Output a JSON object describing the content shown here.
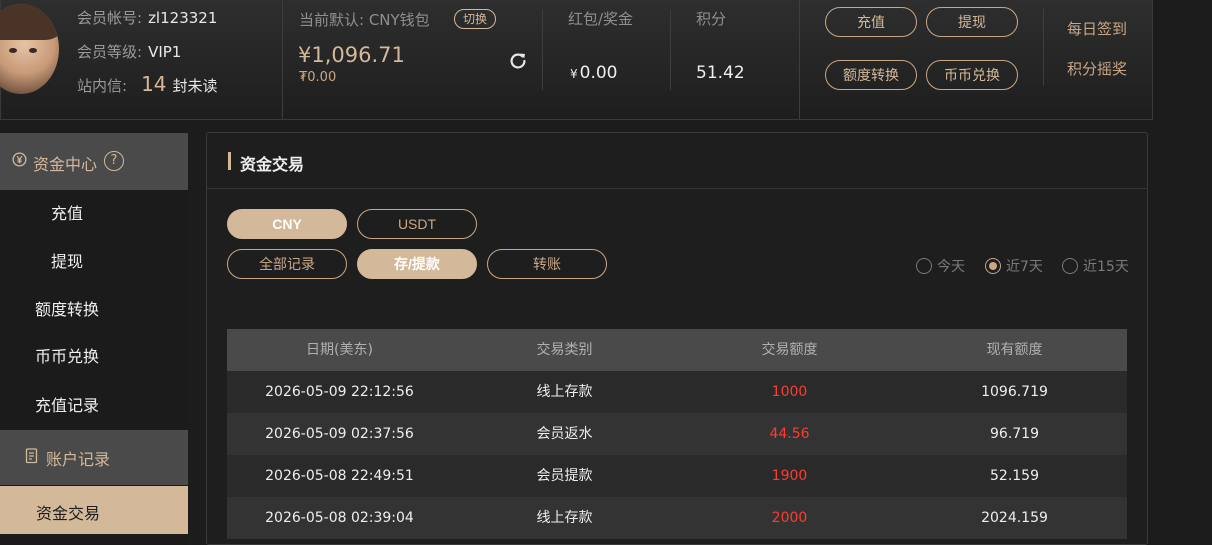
{
  "header": {
    "account_label": "会员帐号:",
    "account_value": "zl123321",
    "level_label": "会员等级:",
    "level_value": "VIP1",
    "mail_label": "站内信:",
    "mail_count": "14",
    "mail_suffix": "封未读",
    "default_wallet_label": "当前默认: CNY钱包",
    "switch_label": "切换",
    "balance": "¥1,096.71",
    "balance_sub": "₮0.00",
    "bonus_label": "红包/奖金",
    "bonus_currency": "¥",
    "bonus_value": "0.00",
    "points_label": "积分",
    "points_value": "51.42",
    "buttons": {
      "recharge": "充值",
      "withdraw": "提现",
      "transfer": "额度转换",
      "exchange": "币币兑换"
    },
    "daily_checkin": "每日签到",
    "points_lottery": "积分摇奖"
  },
  "sidebar": {
    "section_title": "资金中心",
    "items": [
      "充值",
      "提现",
      "额度转换",
      "币币兑换",
      "充值记录"
    ],
    "group_title": "账户记录",
    "active_item": "资金交易"
  },
  "main": {
    "title": "资金交易",
    "currency_tabs": [
      "CNY",
      "USDT"
    ],
    "active_currency": "CNY",
    "record_tabs": [
      "全部记录",
      "存/提款",
      "转账"
    ],
    "active_record_tab": "存/提款",
    "date_filters": [
      "今天",
      "近7天",
      "近15天"
    ],
    "active_date_filter": "近7天",
    "table": {
      "headers": [
        "日期(美东)",
        "交易类别",
        "交易额度",
        "现有额度"
      ],
      "rows": [
        [
          "2026-05-09 22:12:56",
          "线上存款",
          "1000",
          "1096.719"
        ],
        [
          "2026-05-09 02:37:56",
          "会员返水",
          "44.56",
          "96.719"
        ],
        [
          "2026-05-08 22:49:51",
          "会员提款",
          "1900",
          "52.159"
        ],
        [
          "2026-05-08 02:39:04",
          "线上存款",
          "2000",
          "2024.159"
        ]
      ]
    }
  },
  "colors": {
    "accent": "#d4b89a",
    "amount": "#ff3b30"
  }
}
